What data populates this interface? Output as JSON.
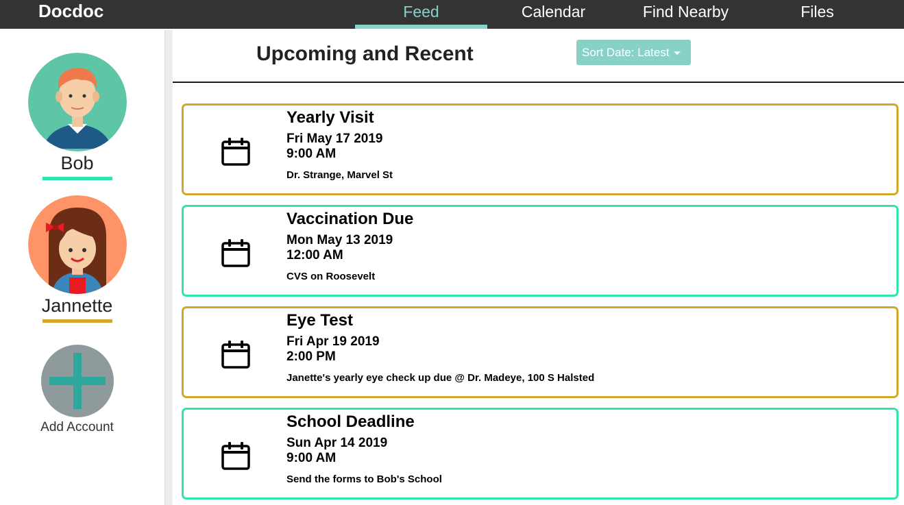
{
  "app": {
    "brand": "Docdoc"
  },
  "nav": {
    "tabs": [
      {
        "label": "Feed",
        "active": true
      },
      {
        "label": "Calendar",
        "active": false
      },
      {
        "label": "Find Nearby",
        "active": false
      },
      {
        "label": "Files",
        "active": false
      }
    ]
  },
  "sidebar": {
    "accounts": [
      {
        "name": "Bob",
        "underline_color": "#2de5ad"
      },
      {
        "name": "Jannette",
        "underline_color": "#d4a72c"
      }
    ],
    "add_account_label": "Add Account"
  },
  "header": {
    "title": "Upcoming and Recent",
    "sort_label": "Sort Date: Latest"
  },
  "feed": [
    {
      "title": "Yearly Visit",
      "date": "Fri May 17 2019",
      "time": "9:00 AM",
      "location": "Dr. Strange, Marvel St",
      "accent": "#d4a72c",
      "icon": "calendar-icon"
    },
    {
      "title": "Vaccination Due",
      "date": "Mon May 13 2019",
      "time": "12:00 AM",
      "location": "CVS on Roosevelt",
      "accent": "#2de5ad",
      "icon": "calendar-icon"
    },
    {
      "title": "Eye Test",
      "date": "Fri Apr 19 2019",
      "time": "2:00 PM",
      "location": "Janette's yearly eye check up due @ Dr. Madeye, 100 S Halsted",
      "accent": "#d4a72c",
      "icon": "calendar-icon"
    },
    {
      "title": "School Deadline",
      "date": "Sun Apr 14 2019",
      "time": "9:00 AM",
      "location": "Send the forms to Bob's School",
      "accent": "#2de5ad",
      "icon": "calendar-icon"
    }
  ],
  "colors": {
    "topbar": "#333333",
    "accent_teal": "#88d1c7",
    "gold": "#d4a72c",
    "green": "#2de5ad"
  }
}
